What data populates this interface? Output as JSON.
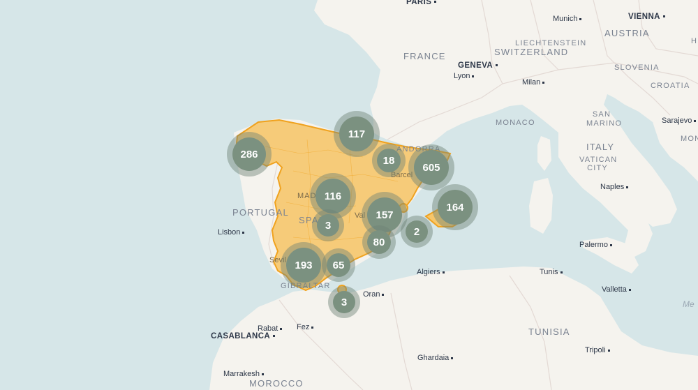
{
  "map": {
    "colors": {
      "sea": "#d6e6e8",
      "land": "#f5f3ee",
      "border": "#e3d9d4",
      "region_fill": "#f6c66b",
      "region_stroke": "#f0a21e",
      "cluster_outer": "rgba(110,130,118,0.45)",
      "cluster_inner": "#7b9180",
      "cluster_text": "#ffffff"
    },
    "countries": [
      {
        "id": "france",
        "label": "FRANCE"
      },
      {
        "id": "switzerland",
        "label": "SWITZERLAND"
      },
      {
        "id": "liechtenstein",
        "label": "LIECHTENSTEIN"
      },
      {
        "id": "austria",
        "label": "AUSTRIA"
      },
      {
        "id": "slovenia",
        "label": "SLOVENIA"
      },
      {
        "id": "croatia",
        "label": "CROATIA"
      },
      {
        "id": "monaco",
        "label": "MONACO"
      },
      {
        "id": "san-marino",
        "label": "SAN MARINO"
      },
      {
        "id": "italy",
        "label": "ITALY"
      },
      {
        "id": "vatican",
        "label": "VATICAN CITY"
      },
      {
        "id": "andorra",
        "label": "ANDORRA"
      },
      {
        "id": "portugal",
        "label": "PORTUGAL"
      },
      {
        "id": "spain",
        "label": "SPAIN"
      },
      {
        "id": "gibraltar",
        "label": "GIBRALTAR"
      },
      {
        "id": "tunisia",
        "label": "TUNISIA"
      },
      {
        "id": "morocco",
        "label": "MOROCCO"
      },
      {
        "id": "mont",
        "label": "MON"
      },
      {
        "id": "hun",
        "label": "H"
      }
    ],
    "capitals": [
      {
        "id": "paris",
        "label": "PARIS"
      },
      {
        "id": "vienna",
        "label": "VIENNA"
      },
      {
        "id": "geneva",
        "label": "GENEVA"
      },
      {
        "id": "casablanca",
        "label": "CASABLANCA"
      }
    ],
    "cities": [
      {
        "id": "munich",
        "label": "Munich"
      },
      {
        "id": "lyon",
        "label": "Lyon"
      },
      {
        "id": "milan",
        "label": "Milan"
      },
      {
        "id": "sarajevo",
        "label": "Sarajevo"
      },
      {
        "id": "barcelona",
        "label": "Barcel"
      },
      {
        "id": "madrid",
        "label": "MAD"
      },
      {
        "id": "valencia",
        "label": "Val"
      },
      {
        "id": "sevilla",
        "label": "Sevil"
      },
      {
        "id": "lisbon",
        "label": "Lisbon"
      },
      {
        "id": "naples",
        "label": "Naples"
      },
      {
        "id": "palermo",
        "label": "Palermo"
      },
      {
        "id": "tunis",
        "label": "Tunis"
      },
      {
        "id": "valletta",
        "label": "Valletta"
      },
      {
        "id": "algiers",
        "label": "Algiers"
      },
      {
        "id": "oran",
        "label": "Oran"
      },
      {
        "id": "rabat",
        "label": "Rabat"
      },
      {
        "id": "fez",
        "label": "Fez"
      },
      {
        "id": "marrakesh",
        "label": "Marrakesh"
      },
      {
        "id": "ghardaia",
        "label": "Ghardaia"
      },
      {
        "id": "tripoli",
        "label": "Tripoli"
      }
    ],
    "sea_labels": [
      {
        "id": "mediterranean",
        "label": "Me"
      }
    ],
    "clusters": [
      {
        "id": "c286",
        "count": "286"
      },
      {
        "id": "c117",
        "count": "117"
      },
      {
        "id": "c18",
        "count": "18"
      },
      {
        "id": "c605",
        "count": "605"
      },
      {
        "id": "c116",
        "count": "116"
      },
      {
        "id": "c164",
        "count": "164"
      },
      {
        "id": "c157",
        "count": "157"
      },
      {
        "id": "c3a",
        "count": "3"
      },
      {
        "id": "c2",
        "count": "2"
      },
      {
        "id": "c80",
        "count": "80"
      },
      {
        "id": "c193",
        "count": "193"
      },
      {
        "id": "c65",
        "count": "65"
      },
      {
        "id": "c3b",
        "count": "3"
      }
    ]
  }
}
